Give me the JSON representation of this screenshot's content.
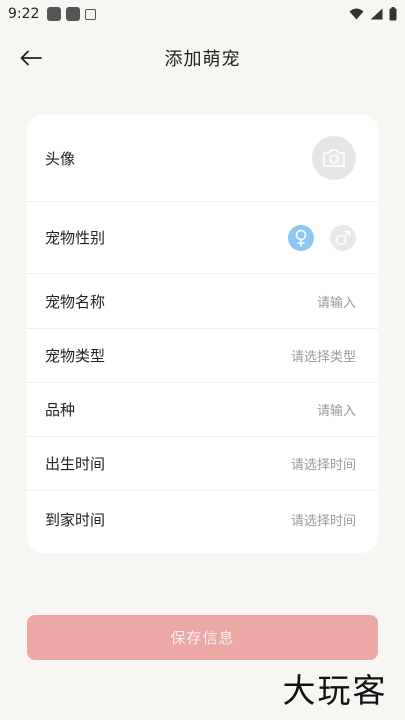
{
  "status_bar": {
    "time": "9:22"
  },
  "header": {
    "title": "添加萌宠"
  },
  "form": {
    "avatar_label": "头像",
    "gender_label": "宠物性别",
    "name_label": "宠物名称",
    "name_placeholder": "请输入",
    "type_label": "宠物类型",
    "type_placeholder": "请选择类型",
    "breed_label": "品种",
    "breed_placeholder": "请输入",
    "birth_label": "出生时间",
    "birth_placeholder": "请选择时间",
    "arrival_label": "到家时间",
    "arrival_placeholder": "请选择时间",
    "gender_selected": "female"
  },
  "actions": {
    "save_label": "保存信息"
  },
  "watermark": {
    "text": "大玩客"
  },
  "colors": {
    "background": "#f8f6f3",
    "save_button": "#eba8a4",
    "female_selected": "#8cc8f3"
  },
  "icons": [
    "back-arrow-icon",
    "camera-icon",
    "female-icon",
    "male-icon",
    "wifi-icon",
    "signal-icon",
    "battery-icon"
  ]
}
